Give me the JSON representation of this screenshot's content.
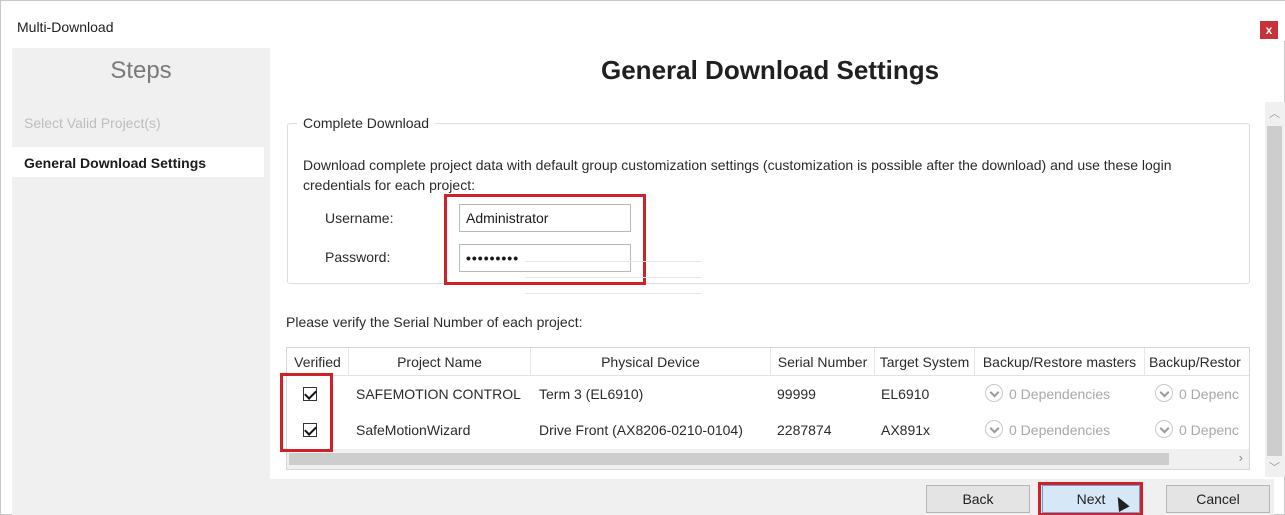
{
  "window": {
    "title": "Multi-Download",
    "close_glyph": "x"
  },
  "steps": {
    "header": "Steps",
    "items": [
      {
        "label": "Select Valid Project(s)",
        "state": "done"
      },
      {
        "label": "General Download Settings",
        "state": "active"
      }
    ]
  },
  "main": {
    "title": "General Download Settings",
    "complete_download": {
      "group_label": "Complete Download",
      "description": "Download complete project data with default group customization settings (customization is possible after the download) and use these login credentials for each project:",
      "username_label": "Username:",
      "username_value": "Administrator",
      "password_label": "Password:",
      "password_value": "•••••••••"
    },
    "verify_prompt": "Please verify the Serial Number of each project:",
    "table": {
      "columns": [
        "Verified",
        "Project Name",
        "Physical Device",
        "Serial Number",
        "Target System",
        "Backup/Restore masters",
        "Backup/Restor"
      ],
      "rows": [
        {
          "verified": true,
          "project_name": "SAFEMOTION CONTROL",
          "physical_device": "Term 3 (EL6910)",
          "serial_number": "99999",
          "target_system": "EL6910",
          "backup_masters": "0 Dependencies",
          "backup_restor": "0 Depenc"
        },
        {
          "verified": true,
          "project_name": "SafeMotionWizard",
          "physical_device": "Drive Front (AX8206-0210-0104)",
          "serial_number": "2287874",
          "target_system": "AX891x",
          "backup_masters": "0 Dependencies",
          "backup_restor": "0 Depenc"
        }
      ]
    }
  },
  "buttons": {
    "back": "Back",
    "next": "Next",
    "cancel": "Cancel"
  },
  "icons": {
    "close": "close-icon",
    "checkbox": "checkbox-checked-icon",
    "dependency": "chevron-down-circle-icon",
    "scroll_right": "chevron-right-icon",
    "scroll_up": "chevron-up-icon",
    "scroll_down": "chevron-down-icon",
    "cursor": "mouse-cursor-icon"
  },
  "colors": {
    "highlight_frame": "#d0202a",
    "primary_button": "#d6e8f7",
    "close_button": "#c8333a"
  }
}
